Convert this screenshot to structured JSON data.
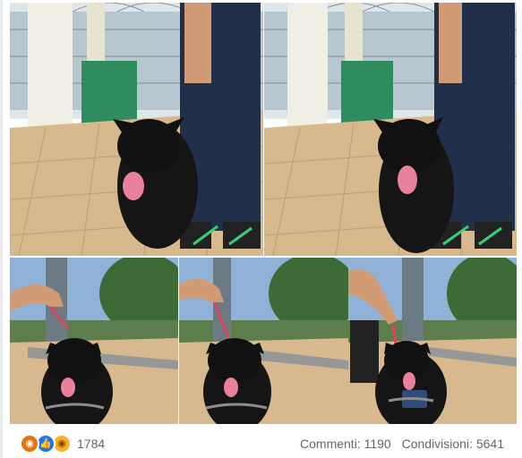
{
  "post": {
    "photos": [
      {
        "name": "Dog sitting on tiled terrace photo 1"
      },
      {
        "name": "Dog sitting on tiled terrace photo 2"
      },
      {
        "name": "Dog on leash photo 3"
      },
      {
        "name": "Dog on leash photo 4"
      },
      {
        "name": "Dog with harness photo 5"
      }
    ],
    "reactions": {
      "icons": [
        "angry-icon",
        "like-icon",
        "sad-icon"
      ],
      "count": "1784"
    },
    "comments_label": "Commenti: 1190",
    "shares_label": "Condivisioni: 5641"
  },
  "colors": {
    "page_bg": "#e9ebee",
    "like_blue": "#1877f2",
    "angry_orange": "#e9710f",
    "sad_yellow": "#f7b125",
    "meta_text": "#606770"
  }
}
